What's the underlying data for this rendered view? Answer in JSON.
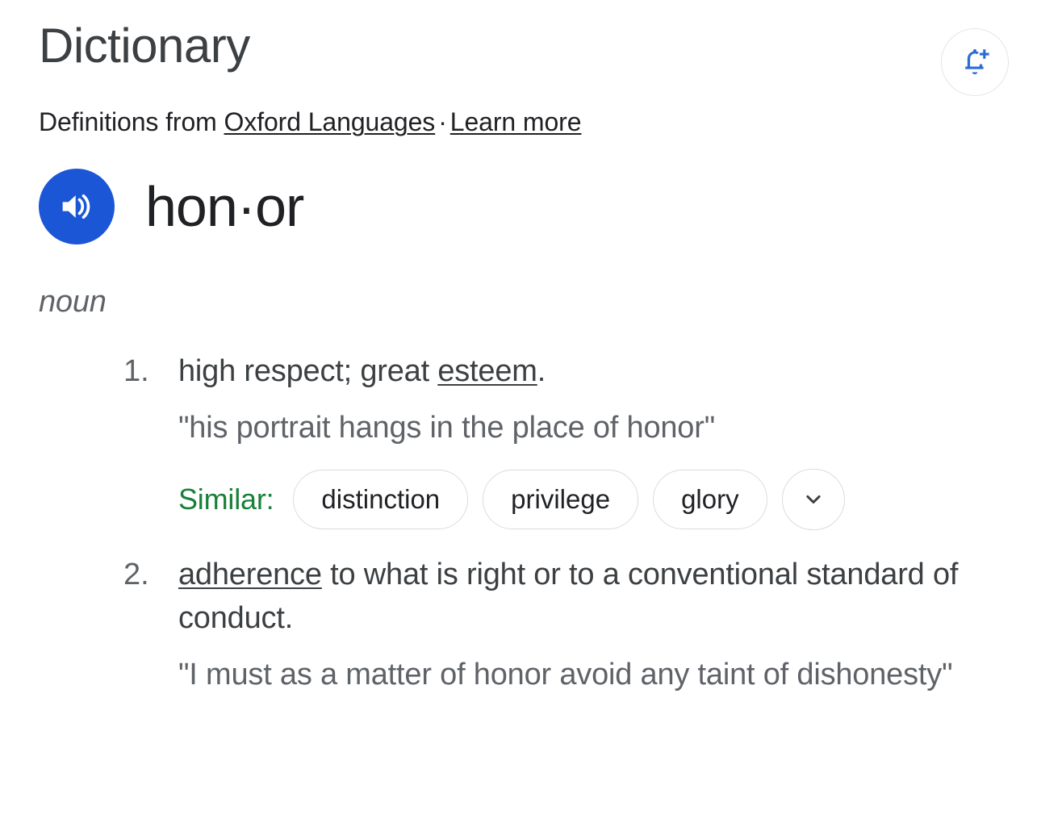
{
  "header": {
    "title": "Dictionary",
    "notification_button": {
      "icon": "add-alert-bell-icon",
      "color": "#2b6cd4"
    }
  },
  "source": {
    "prefix": "Definitions from ",
    "source_link": "Oxford Languages",
    "separator": "·",
    "learn_more_link": "Learn more"
  },
  "word": {
    "headword": "hon·or",
    "pronounce_icon": "speaker-volume-icon",
    "pronounce_bg": "#1a56d6"
  },
  "part_of_speech": "noun",
  "definitions": [
    {
      "number": "1.",
      "text_before_link": "high respect; great ",
      "link": "esteem",
      "text_after_link": ".",
      "example": "\"his portrait hangs in the place of honor\"",
      "similar": {
        "label": "Similar:",
        "label_color": "#188038",
        "chips": [
          "distinction",
          "privilege",
          "glory"
        ],
        "expand_icon": "chevron-down-icon"
      }
    },
    {
      "number": "2.",
      "text_before_link": "",
      "link": "adherence",
      "text_after_link": " to what is right or to a conventional standard of conduct.",
      "example": "\"I must as a matter of honor avoid any taint of dishonesty\""
    }
  ]
}
